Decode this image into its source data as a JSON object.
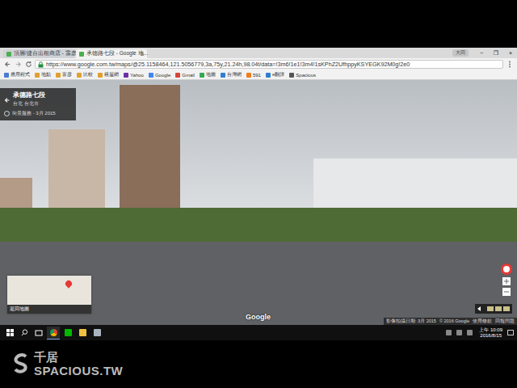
{
  "browser": {
    "tabs": [
      {
        "label": "頂層/捷台出租商店 - 富彦...",
        "selected": false,
        "close": "×"
      },
      {
        "label": "承德路七段 - Google 地...",
        "selected": true,
        "close": "×"
      }
    ],
    "profile": "大同",
    "window_controls": [
      "−",
      "❐",
      "×"
    ],
    "url": "https://www.google.com.tw/maps/@25.1158464,121.5056779,3a,75y,21.24h,98.04t/data=!3m6!1e1!3m4!1sKPhZ2UfhppyKSYEGK92M0g!2e0",
    "bookmarks": [
      {
        "label": "應用程式",
        "color": "#4a7bd0"
      },
      {
        "label": "地點",
        "color": "#e0a030"
      },
      {
        "label": "富彦",
        "color": "#e0a030"
      },
      {
        "label": "比較",
        "color": "#e0a030"
      },
      {
        "label": "租屋網",
        "color": "#e0a030"
      },
      {
        "label": "Yahoo",
        "color": "#6b2fa8"
      },
      {
        "label": "Google",
        "color": "#4285f4"
      },
      {
        "label": "Gmail",
        "color": "#d44638"
      },
      {
        "label": "地圖",
        "color": "#34a853"
      },
      {
        "label": "台灣網",
        "color": "#2f7fd0"
      },
      {
        "label": "591",
        "color": "#f07d1a"
      },
      {
        "label": "e翻譯",
        "color": "#2f7fd0"
      },
      {
        "label": "Spacious",
        "color": "#555555"
      }
    ]
  },
  "street_view": {
    "place": "承德路七段",
    "city": "台北 台北市",
    "capture": "街景服務 - 3月 2015",
    "back_to_map": "返回地圖",
    "logo": "Google",
    "footer": [
      "影像拍攝日期: 3月 2015",
      "© 2016 Google",
      "使用條款",
      "回報問題"
    ]
  },
  "taskbar": {
    "time": "上午 10:09",
    "date": "2016/8/15"
  },
  "watermark": {
    "chinese": "千居",
    "brand": "SPACIOUS.TW"
  }
}
